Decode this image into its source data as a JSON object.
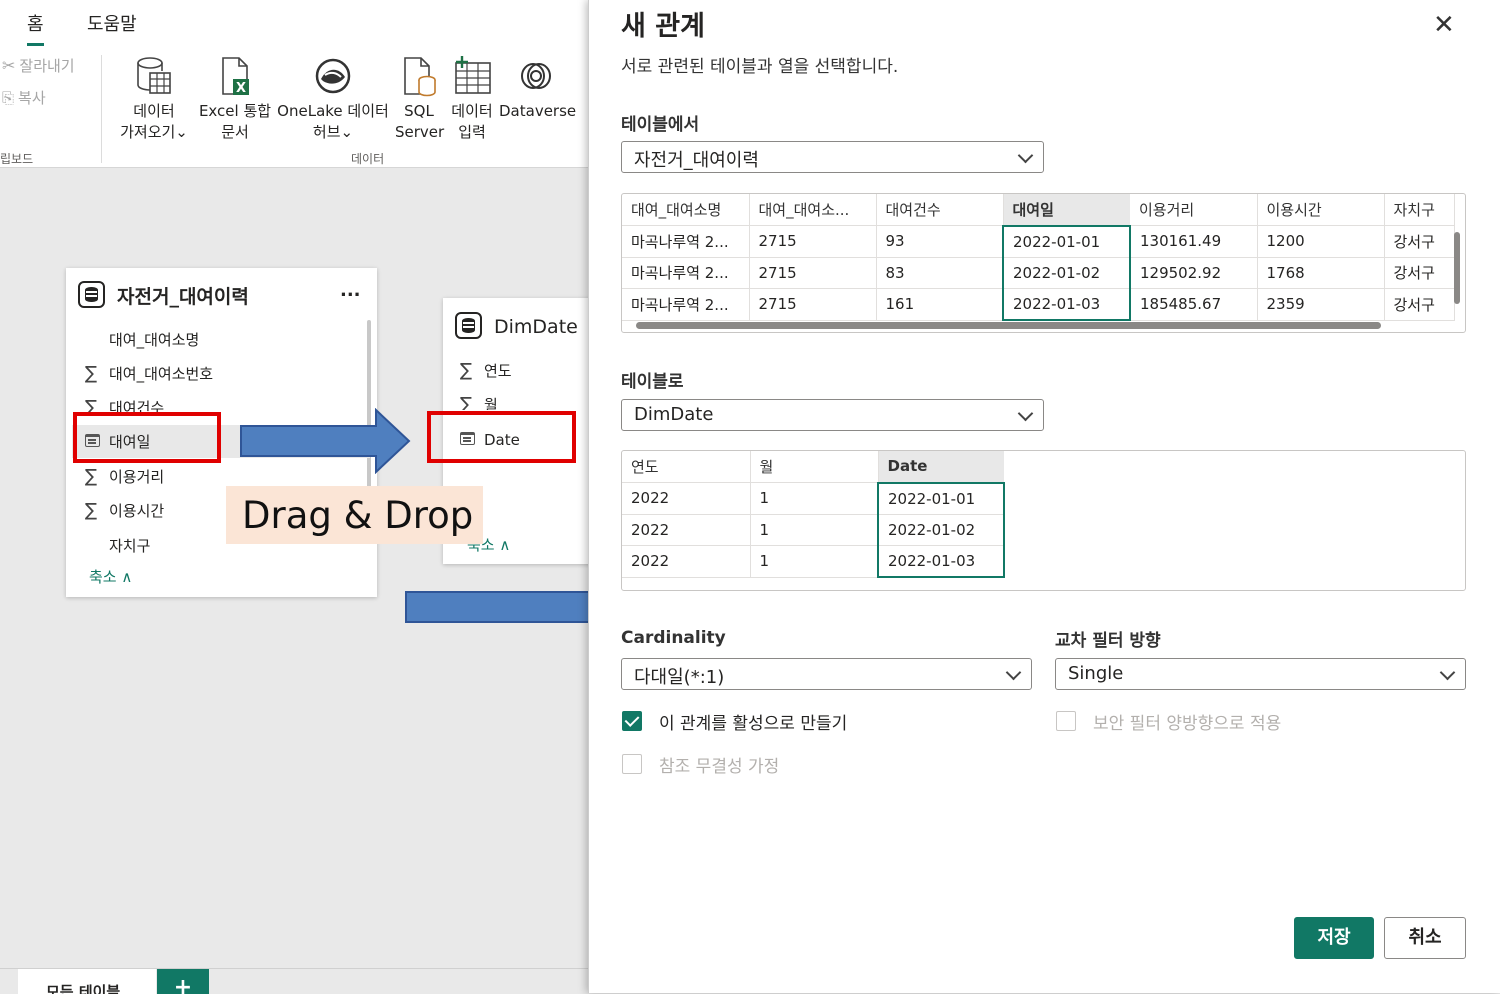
{
  "ribbon": {
    "tabs": [
      "홈",
      "도움말"
    ],
    "clipboard": {
      "cut": "잘라내기",
      "copy": "복사",
      "group": "립보드"
    },
    "buttons": [
      {
        "l1": "데이터",
        "l2": "가져오기⌄",
        "icon": "database-table-icon"
      },
      {
        "l1": "Excel 통합",
        "l2": "문서",
        "icon": "excel-icon"
      },
      {
        "l1": "OneLake 데이터",
        "l2": "허브⌄",
        "icon": "onelake-icon"
      },
      {
        "l1": "SQL",
        "l2": "Server",
        "icon": "sql-server-icon"
      },
      {
        "l1": "데이터",
        "l2": "입력",
        "icon": "enter-data-icon"
      },
      {
        "l1": "Dataverse",
        "l2": "",
        "icon": "dataverse-icon"
      }
    ],
    "data_group": "데이터"
  },
  "canvas": {
    "table1": {
      "title": "자전거_대여이력",
      "more": "...",
      "fields": [
        {
          "label": "대여_대여소명",
          "type": "text"
        },
        {
          "label": "대여_대여소번호",
          "type": "sum"
        },
        {
          "label": "대여건수",
          "type": "sum"
        },
        {
          "label": "대여일",
          "type": "date"
        },
        {
          "label": "이용거리",
          "type": "sum"
        },
        {
          "label": "이용시간",
          "type": "sum"
        },
        {
          "label": "자치구",
          "type": "text"
        }
      ],
      "collapse": "축소 ∧"
    },
    "table2": {
      "title": "DimDate",
      "fields": [
        {
          "label": "연도",
          "type": "sum"
        },
        {
          "label": "월",
          "type": "sum"
        },
        {
          "label": "Date",
          "type": "date"
        }
      ],
      "collapse": "축소 ∧"
    },
    "drag_label": "Drag & Drop",
    "bottom_tabs": [
      "모든 테이블",
      "+"
    ]
  },
  "dialog": {
    "title": "새 관계",
    "close": "✕",
    "subtitle": "서로 관련된 테이블과 열을 선택합니다.",
    "from_label": "테이블에서",
    "from_table": "자전거_대여이력",
    "from_grid": {
      "headers": [
        "대여_대여소명",
        "대여_대여소...",
        "대여건수",
        "대여일",
        "이용거리",
        "이용시간",
        "자치구"
      ],
      "rows": [
        [
          "마곡나루역 2...",
          "2715",
          "93",
          "2022-01-01",
          "130161.49",
          "1200",
          "강서구"
        ],
        [
          "마곡나루역 2...",
          "2715",
          "83",
          "2022-01-02",
          "129502.92",
          "1768",
          "강서구"
        ],
        [
          "마곡나루역 2...",
          "2715",
          "161",
          "2022-01-03",
          "185485.67",
          "2359",
          "강서구"
        ]
      ]
    },
    "to_label": "테이블로",
    "to_table": "DimDate",
    "to_grid": {
      "headers": [
        "연도",
        "월",
        "Date"
      ],
      "rows": [
        [
          "2022",
          "1",
          "2022-01-01"
        ],
        [
          "2022",
          "1",
          "2022-01-02"
        ],
        [
          "2022",
          "1",
          "2022-01-03"
        ]
      ]
    },
    "cardinality_label": "Cardinality",
    "cardinality_value": "다대일(*:1)",
    "cross_filter_label": "교차 필터 방향",
    "cross_filter_value": "Single",
    "checkboxes": {
      "active": {
        "label": "이 관계를 활성으로 만들기",
        "checked": true
      },
      "security": {
        "label": "보안 필터 양방향으로 적용",
        "checked": false
      },
      "integrity": {
        "label": "참조 무결성 가정",
        "checked": false
      }
    },
    "save": "저장",
    "cancel": "취소"
  },
  "colors": {
    "accent": "#117865",
    "highlight": "#e00000",
    "arrow": "#4f7fbf",
    "label_bg": "#fbe5d6"
  }
}
